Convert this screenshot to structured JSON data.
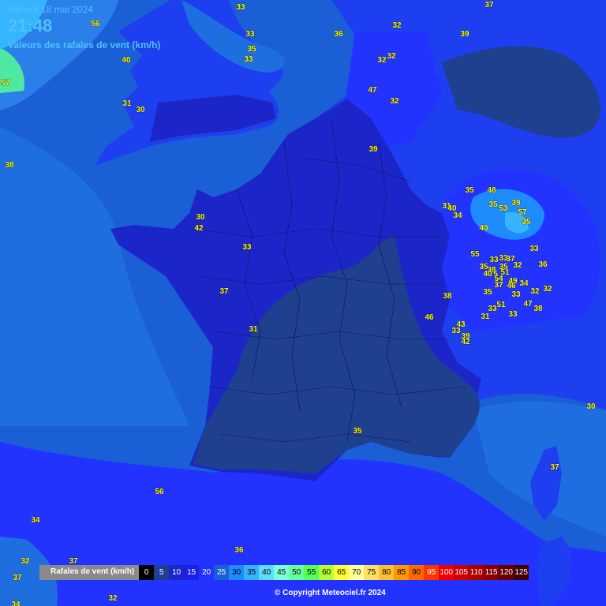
{
  "header": {
    "date": "samedi 18 mai 2024",
    "time": "21:48",
    "subtitle": "Valeurs des rafales de vent (km/h)"
  },
  "colors": {
    "sea": "#1a5fd6",
    "land_medium": "#1e3ff0",
    "land_dark": "#1c26c8",
    "calm_zone": "#1f3f8f",
    "light_sea": "#2b7fe8",
    "label": "#ffff00"
  },
  "stations": [
    {
      "v": "56"
    },
    {
      "v": "40"
    },
    {
      "v": "57"
    },
    {
      "v": "31"
    },
    {
      "v": "30"
    },
    {
      "v": "38"
    },
    {
      "v": "33"
    },
    {
      "v": "33"
    },
    {
      "v": "35"
    },
    {
      "v": "33"
    },
    {
      "v": "36"
    },
    {
      "v": "32"
    },
    {
      "v": "32"
    },
    {
      "v": "32"
    },
    {
      "v": "47"
    },
    {
      "v": "32"
    },
    {
      "v": "37"
    },
    {
      "v": "39"
    },
    {
      "v": "39"
    },
    {
      "v": "35"
    },
    {
      "v": "48"
    },
    {
      "v": "35"
    },
    {
      "v": "53"
    },
    {
      "v": "39"
    },
    {
      "v": "57"
    },
    {
      "v": "35"
    },
    {
      "v": "31"
    },
    {
      "v": "40"
    },
    {
      "v": "34"
    },
    {
      "v": "40"
    },
    {
      "v": "30"
    },
    {
      "v": "42"
    },
    {
      "v": "33"
    },
    {
      "v": "37"
    },
    {
      "v": "31"
    },
    {
      "v": "55"
    },
    {
      "v": "33"
    },
    {
      "v": "33"
    },
    {
      "v": "37"
    },
    {
      "v": "33"
    },
    {
      "v": "32"
    },
    {
      "v": "36"
    },
    {
      "v": "35"
    },
    {
      "v": "38"
    },
    {
      "v": "40"
    },
    {
      "v": "5"
    },
    {
      "v": "51"
    },
    {
      "v": "35"
    },
    {
      "v": "54"
    },
    {
      "v": "49"
    },
    {
      "v": "34"
    },
    {
      "v": "37"
    },
    {
      "v": "46"
    },
    {
      "v": "35"
    },
    {
      "v": "33"
    },
    {
      "v": "32"
    },
    {
      "v": "32"
    },
    {
      "v": "38"
    },
    {
      "v": "47"
    },
    {
      "v": "38"
    },
    {
      "v": "51"
    },
    {
      "v": "33"
    },
    {
      "v": "31"
    },
    {
      "v": "33"
    },
    {
      "v": "46"
    },
    {
      "v": "43"
    },
    {
      "v": "33"
    },
    {
      "v": "39"
    },
    {
      "v": "42"
    },
    {
      "v": "35"
    },
    {
      "v": "30"
    },
    {
      "v": "56"
    },
    {
      "v": "37"
    },
    {
      "v": "34"
    },
    {
      "v": "36"
    },
    {
      "v": "32"
    },
    {
      "v": "37"
    },
    {
      "v": "37"
    },
    {
      "v": "32"
    },
    {
      "v": "34"
    }
  ],
  "legend": {
    "title": "Rafales de vent (km/h)",
    "steps": [
      {
        "label": "0",
        "bg": "#000000",
        "fg": "#ffffff"
      },
      {
        "label": "5",
        "bg": "#1f3f8f",
        "fg": "#ffffff"
      },
      {
        "label": "10",
        "bg": "#1c26c8",
        "fg": "#ffffff"
      },
      {
        "label": "15",
        "bg": "#1e1ee6",
        "fg": "#ffffff"
      },
      {
        "label": "20",
        "bg": "#2233ff",
        "fg": "#ffffff"
      },
      {
        "label": "25",
        "bg": "#1a5fd6",
        "fg": "#ffffff"
      },
      {
        "label": "30",
        "bg": "#1e8cff",
        "fg": "#000000"
      },
      {
        "label": "35",
        "bg": "#36b4ff",
        "fg": "#000000"
      },
      {
        "label": "40",
        "bg": "#5fdcff",
        "fg": "#000000"
      },
      {
        "label": "45",
        "bg": "#7fffd8",
        "fg": "#000000"
      },
      {
        "label": "50",
        "bg": "#66ffa0",
        "fg": "#000000"
      },
      {
        "label": "55",
        "bg": "#55ff55",
        "fg": "#000000"
      },
      {
        "label": "60",
        "bg": "#b4ff33",
        "fg": "#000000"
      },
      {
        "label": "65",
        "bg": "#ffff33",
        "fg": "#000000"
      },
      {
        "label": "70",
        "bg": "#ffff99",
        "fg": "#000000"
      },
      {
        "label": "75",
        "bg": "#ffe066",
        "fg": "#000000"
      },
      {
        "label": "80",
        "bg": "#ffbf33",
        "fg": "#000000"
      },
      {
        "label": "85",
        "bg": "#ff9900",
        "fg": "#000000"
      },
      {
        "label": "90",
        "bg": "#ff6a00",
        "fg": "#000000"
      },
      {
        "label": "95",
        "bg": "#ff3300",
        "fg": "#ffffff"
      },
      {
        "label": "100",
        "bg": "#ee0000",
        "fg": "#ffffff"
      },
      {
        "label": "105",
        "bg": "#cc0000",
        "fg": "#ffffff"
      },
      {
        "label": "110",
        "bg": "#aa0000",
        "fg": "#ffffff"
      },
      {
        "label": "115",
        "bg": "#880000",
        "fg": "#ffffff"
      },
      {
        "label": "120",
        "bg": "#660000",
        "fg": "#ffffff"
      },
      {
        "label": "125",
        "bg": "#440000",
        "fg": "#ffffff"
      }
    ]
  },
  "copyright": "© Copyright Meteociel.fr 2024"
}
